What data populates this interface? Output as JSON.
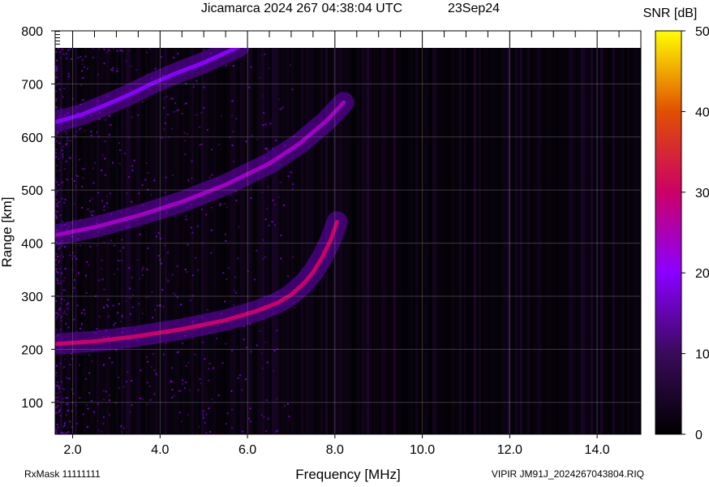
{
  "chart_data": {
    "type": "heatmap",
    "title": "Jicamarca 2024 267 04:38:04 UTC",
    "date_label": "23Sep24",
    "xlabel": "Frequency [MHz]",
    "ylabel": "Range [km]",
    "xlim": [
      1.6,
      15.0
    ],
    "ylim": [
      40,
      800
    ],
    "x_ticks": [
      "2.0",
      "4.0",
      "6.0",
      "8.0",
      "10.0",
      "12.0",
      "14.0"
    ],
    "x_tick_values": [
      2,
      4,
      6,
      8,
      10,
      12,
      14
    ],
    "y_ticks": [
      "100",
      "200",
      "300",
      "400",
      "500",
      "600",
      "700",
      "800"
    ],
    "y_tick_values": [
      100,
      200,
      300,
      400,
      500,
      600,
      700,
      800
    ],
    "grid": true,
    "colorbar": {
      "label": "SNR [dB]",
      "min": 0,
      "max": 50,
      "ticks": [
        "0",
        "10",
        "20",
        "30",
        "40",
        "50"
      ],
      "tick_values": [
        0,
        10,
        20,
        30,
        40,
        50
      ],
      "colors": [
        "#000000",
        "#3a0a5a",
        "#8a00ff",
        "#cc0066",
        "#e05000",
        "#ffff00"
      ]
    },
    "traces": [
      {
        "points": [
          [
            1.6,
            210
          ],
          [
            2.5,
            215
          ],
          [
            3.5,
            225
          ],
          [
            4.5,
            238
          ],
          [
            5.5,
            255
          ],
          [
            6.2,
            272
          ],
          [
            6.7,
            288
          ],
          [
            7.0,
            303
          ],
          [
            7.3,
            325
          ],
          [
            7.5,
            345
          ],
          [
            7.7,
            372
          ],
          [
            7.9,
            405
          ],
          [
            8.05,
            440
          ]
        ],
        "snr_db": 30
      },
      {
        "points": [
          [
            1.6,
            415
          ],
          [
            2.5,
            430
          ],
          [
            3.5,
            452
          ],
          [
            4.5,
            478
          ],
          [
            5.5,
            510
          ],
          [
            6.5,
            550
          ],
          [
            7.2,
            588
          ],
          [
            7.8,
            630
          ],
          [
            8.2,
            665
          ]
        ],
        "snr_db": 24
      },
      {
        "points": [
          [
            1.6,
            628
          ],
          [
            2.2,
            642
          ],
          [
            2.8,
            662
          ],
          [
            3.3,
            680
          ],
          [
            3.8,
            700
          ],
          [
            4.3,
            718
          ],
          [
            5.0,
            740
          ],
          [
            5.8,
            770
          ]
        ],
        "snr_db": 20
      }
    ]
  },
  "footer": {
    "rxmask": "RxMask 11111111",
    "file": "VIPIR  JM91J_2024267043804.RIQ"
  }
}
